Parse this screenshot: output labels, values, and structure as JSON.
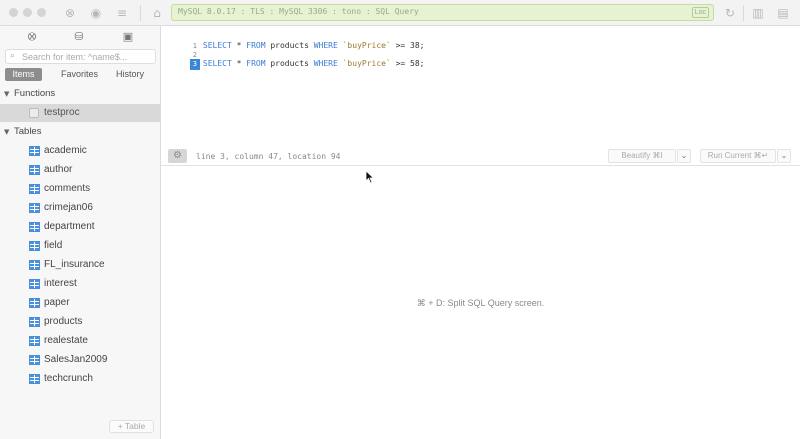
{
  "titlebar": {
    "connection": "MySQL 8.0.17 : TLS : MySQL 3306 : tono : SQL Query",
    "badge": "Loc"
  },
  "sidebar": {
    "search_placeholder": "Search for item: ^name$...",
    "tabs": [
      "Items",
      "Favorites",
      "History"
    ],
    "functions_header": "Functions",
    "functions": [
      "testproc"
    ],
    "tables_header": "Tables",
    "tables": [
      "academic",
      "author",
      "comments",
      "crimejan06",
      "department",
      "field",
      "FL_insurance",
      "interest",
      "paper",
      "products",
      "realestate",
      "SalesJan2009",
      "techcrunch"
    ],
    "add_table_label": "+ Table"
  },
  "editor": {
    "lines": [
      {
        "num": "1",
        "select": "SELECT",
        "star": " * ",
        "from": "FROM",
        "table": " products ",
        "where": "WHERE",
        "col": " `buyPrice`",
        "op": " >= ",
        "val": "38;"
      },
      {
        "num": "2",
        "select": "",
        "star": "",
        "from": "",
        "table": "",
        "where": "",
        "col": "",
        "op": "",
        "val": ""
      },
      {
        "num": "3",
        "select": "SELECT",
        "star": " * ",
        "from": "FROM",
        "table": " products ",
        "where": "WHERE",
        "col": " `buyPrice`",
        "op": " >= ",
        "val": "58;"
      }
    ]
  },
  "statusbar": {
    "cursor_info": "line 3, column 47, location 94",
    "beautify_label": "Beautify ⌘I",
    "run_label": "Run Current ⌘↵"
  },
  "results": {
    "split_hint": "⌘ + D: Split SQL Query screen."
  }
}
